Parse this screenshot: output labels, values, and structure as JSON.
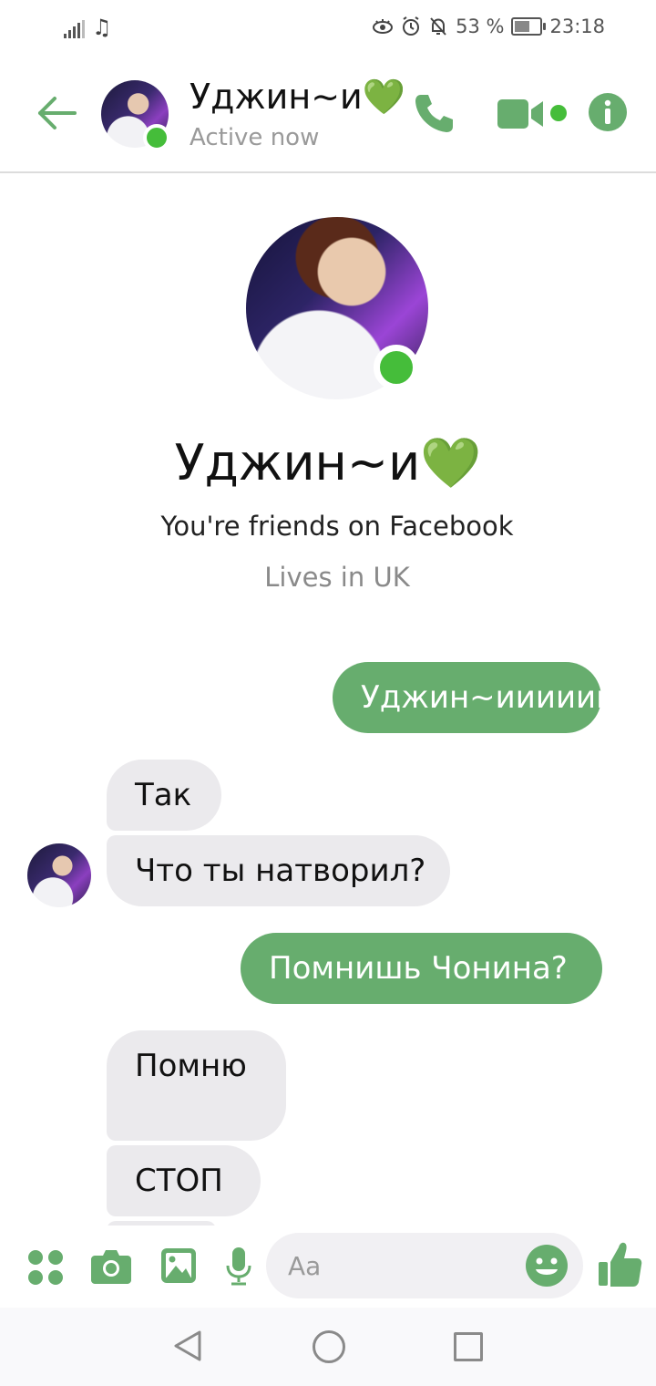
{
  "status_bar": {
    "battery_percent": "53 %",
    "time": "23:18",
    "icons": [
      "signal-icon",
      "music-note-icon",
      "eye-comfort-icon",
      "alarm-icon",
      "notifications-off-icon",
      "battery-charging-icon"
    ]
  },
  "header": {
    "contact_name": "Уджин~и💚",
    "status": "Active now",
    "icons": [
      "back-arrow-icon",
      "phone-icon",
      "video-camera-icon",
      "info-icon"
    ],
    "accent_color": "#67ad6e",
    "online_color": "#45bd3a"
  },
  "profile": {
    "name": "Уджин~и💚",
    "friends_text": "You're friends on Facebook",
    "lives_text": "Lives in UK"
  },
  "messages": [
    {
      "sender": "me",
      "text": "Уджин~ииииии"
    },
    {
      "sender": "contact",
      "text": "Так"
    },
    {
      "sender": "contact",
      "text": "Что ты натворил?"
    },
    {
      "sender": "me",
      "text": "Помнишь Чонина?"
    },
    {
      "sender": "contact",
      "text": "Помню"
    },
    {
      "sender": "contact",
      "text": "СТОП"
    }
  ],
  "composer": {
    "placeholder": "Aa",
    "icons": [
      "apps-grid-icon",
      "camera-icon",
      "gallery-icon",
      "microphone-icon",
      "emoji-icon",
      "thumbs-up-icon"
    ]
  },
  "nav_bar": {
    "icons": [
      "nav-back-icon",
      "nav-home-icon",
      "nav-recents-icon"
    ]
  }
}
